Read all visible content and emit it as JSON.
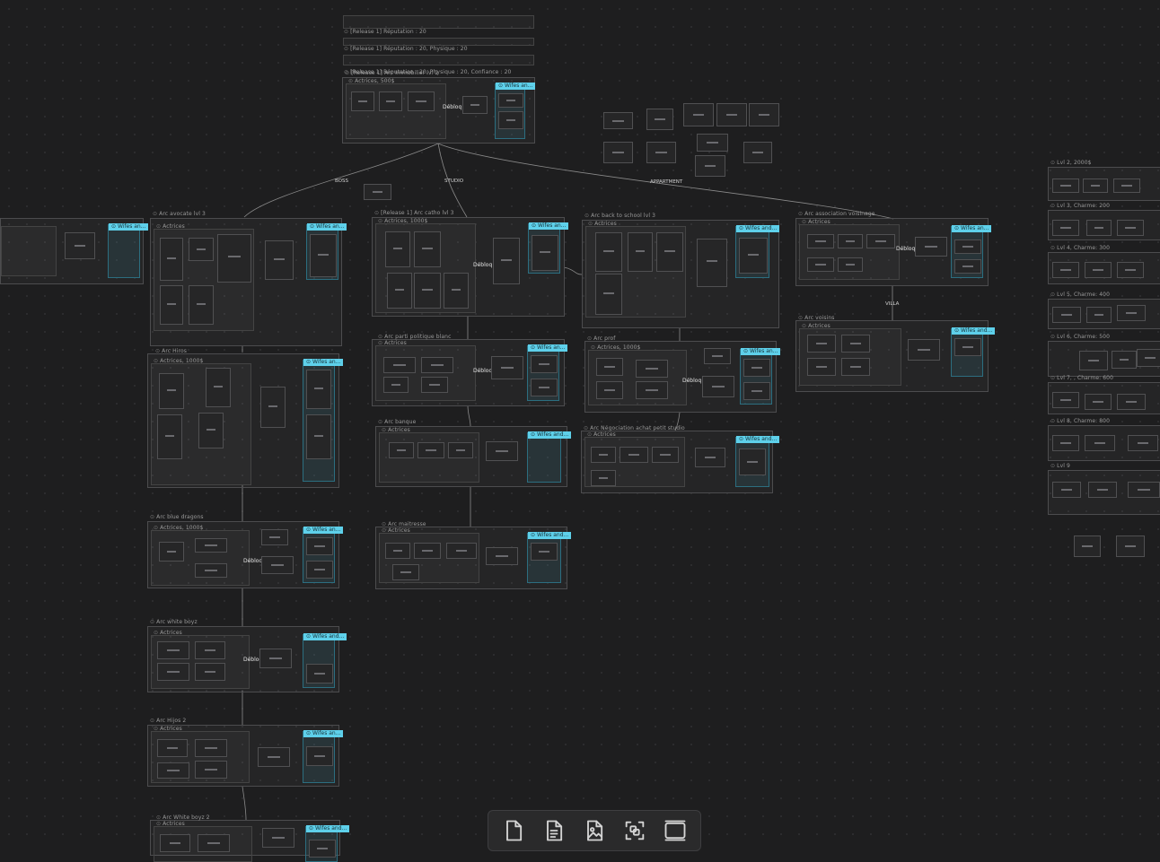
{
  "canvas": {
    "top_labels": [
      "[Release 1] Réputation : 20",
      "[Release 1] Réputation : 20, Physique : 20",
      "[Release 1] Réputation : 20, Physique : 20, Confiance : 20"
    ],
    "root_group": {
      "title": "[Release 1] Arc Immobilier lvl 2",
      "actrices": "Actrices, 500$",
      "wifes": "Wifes an...",
      "debloq": "Débloq"
    },
    "edge_labels": {
      "boss": "BOSS",
      "studio": "STUDIO",
      "appartment": "APPARTMENT",
      "villa": "VILLA"
    },
    "groups": {
      "avocate": {
        "title": "Arc avocate lvl 3",
        "actrices": "Actrices",
        "wifes": "Wifes an..."
      },
      "hiros": {
        "title": "Arc Hiros",
        "actrices": "Actrices, 1000$",
        "wifes": "Wifes an..."
      },
      "blue_dragons": {
        "title": "Arc blue dragons",
        "actrices": "Actrices, 1000$",
        "wifes": "Wifes an...",
        "debloq": "Débloq"
      },
      "white_boyz": {
        "title": "Arc white boyz",
        "actrices": "Actrices",
        "wifes": "Wifes and...",
        "debloq": "Débloq"
      },
      "hijos2": {
        "title": "Arc Hijos 2",
        "actrices": "Actrices",
        "wifes": "Wifes an..."
      },
      "white_boyz2": {
        "title": "Arc White boyz 2",
        "actrices": "Actrices",
        "wifes": "Wifes and..."
      },
      "catho": {
        "title": "[Release 1] Arc catho lvl 3",
        "actrices": "Actrices, 1000$",
        "wifes": "Wifes an...",
        "debloq": "Débloq"
      },
      "parti": {
        "title": "Arc parti politique blanc",
        "actrices": "Actrices",
        "wifes": "Wifes an...",
        "debloq": "Débloq"
      },
      "banque": {
        "title": "Arc banque",
        "actrices": "Actrices",
        "wifes": "Wifes and..."
      },
      "maitresse": {
        "title": "Arc maitresse",
        "actrices": "Actrices",
        "wifes": "Wifes and..."
      },
      "back_school": {
        "title": "Arc back to school lvl 3",
        "actrices": "Actrices",
        "wifes": "Wifes and..."
      },
      "prof": {
        "title": "Arc prof",
        "actrices": "Actrices, 1000$",
        "wifes": "Wifes an...",
        "debloq": "Débloq"
      },
      "negociation": {
        "title": "Arc Négociation achat petit studio",
        "actrices": "Actrices",
        "wifes": "Wifes and..."
      },
      "voisinage": {
        "title": "Arc association voisinage",
        "actrices": "Actrices",
        "wifes": "Wifes an...",
        "debloq": "Débloq"
      },
      "voisins": {
        "title": "Arc voisins",
        "actrices": "Actrices",
        "wifes": "Wifes and..."
      },
      "left_partial": {
        "wifes": "Wifes an..."
      }
    },
    "levels": [
      "Lvl 2, 2000$",
      "Lvl 3, Charme: 200",
      "Lvl 4, Charme: 300",
      "Lvl 5, Charme: 400",
      "Lvl 6, Charme: 500",
      "Lvl 7, , Charme: 600",
      "Lvl 8, Charme: 800",
      "Lvl 9"
    ]
  },
  "toolbar": {
    "items": [
      {
        "name": "new-card",
        "icon": "file-icon"
      },
      {
        "name": "new-note",
        "icon": "file-text-icon"
      },
      {
        "name": "new-media",
        "icon": "image-file-icon"
      },
      {
        "name": "new-group",
        "icon": "group-icon"
      },
      {
        "name": "toggle-panel",
        "icon": "panel-icon"
      }
    ]
  }
}
